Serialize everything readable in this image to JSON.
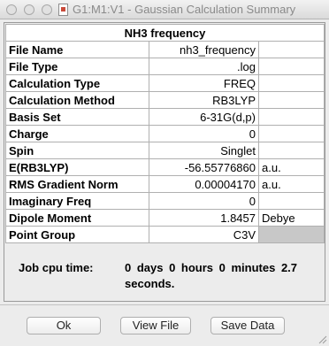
{
  "window": {
    "title": "G1:M1:V1 - Gaussian Calculation Summary"
  },
  "summary": {
    "header": "NH3 frequency",
    "rows": [
      {
        "label": "File Name",
        "value": "nh3_frequency",
        "unit": ""
      },
      {
        "label": "File Type",
        "value": ".log",
        "unit": ""
      },
      {
        "label": "Calculation Type",
        "value": "FREQ",
        "unit": ""
      },
      {
        "label": "Calculation Method",
        "value": "RB3LYP",
        "unit": ""
      },
      {
        "label": "Basis Set",
        "value": "6-31G(d,p)",
        "unit": ""
      },
      {
        "label": "Charge",
        "value": "0",
        "unit": ""
      },
      {
        "label": "Spin",
        "value": "Singlet",
        "unit": ""
      },
      {
        "label": "E(RB3LYP)",
        "value": "-56.55776860",
        "unit": "a.u."
      },
      {
        "label": "RMS Gradient Norm",
        "value": "0.00004170",
        "unit": "a.u."
      },
      {
        "label": "Imaginary Freq",
        "value": "0",
        "unit": ""
      },
      {
        "label": "Dipole Moment",
        "value": "1.8457",
        "unit": "Debye"
      },
      {
        "label": "Point Group",
        "value": "C3V",
        "unit": ""
      }
    ]
  },
  "cpu": {
    "label": "Job cpu time:",
    "value": "0 days 0 hours 0 minutes 2.7 seconds."
  },
  "buttons": {
    "ok": "Ok",
    "view_file": "View File",
    "save_data": "Save Data"
  },
  "icons": {
    "close": "close-button-icon",
    "minimize": "minimize-button-icon",
    "zoom": "zoom-button-icon",
    "document": "document-icon",
    "resize": "resize-grip-icon"
  }
}
